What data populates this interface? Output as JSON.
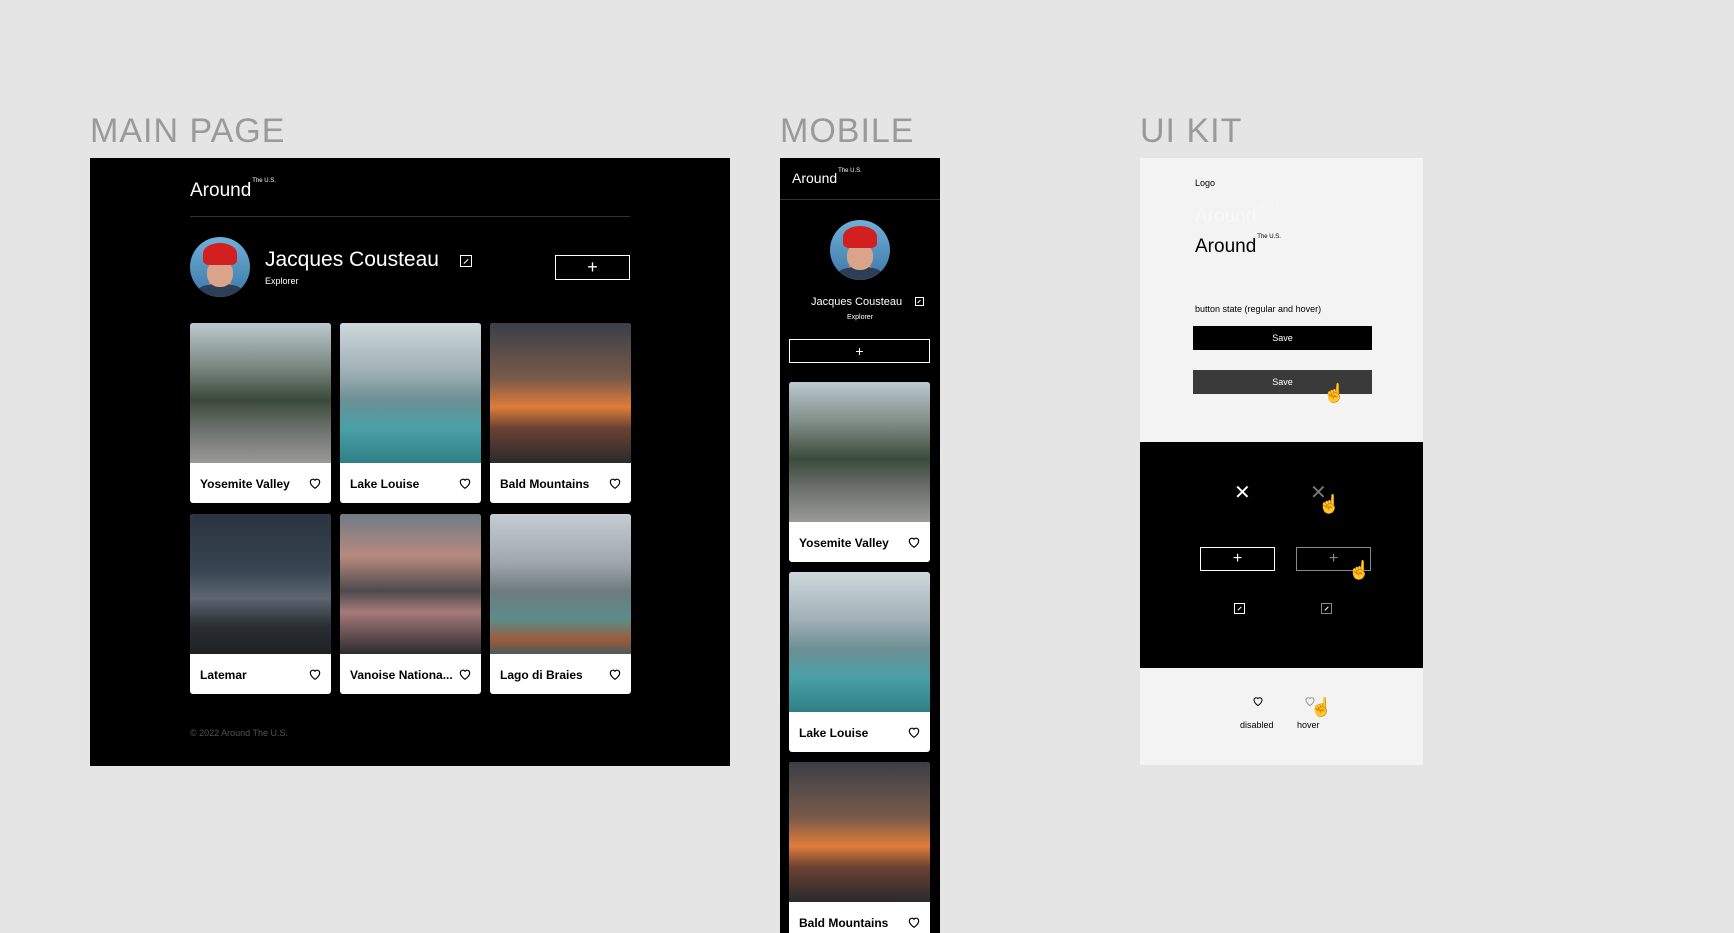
{
  "labels": {
    "main": "MAIN PAGE",
    "mobile": "MOBILE",
    "uikit": "UI KIT"
  },
  "brand": {
    "name": "Around",
    "suffix": "The U.S."
  },
  "profile": {
    "name": "Jacques Cousteau",
    "role": "Explorer"
  },
  "add_symbol": "+",
  "cards": [
    {
      "title": "Yosemite Valley"
    },
    {
      "title": "Lake Louise"
    },
    {
      "title": "Bald Mountains"
    },
    {
      "title": "Latemar"
    },
    {
      "title": "Vanoise Nationa..."
    },
    {
      "title": "Lago di Braies"
    }
  ],
  "footer": "© 2022 Around The U.S.",
  "uikit": {
    "logo_label": "Logo",
    "button_state_label": "button state (regular and hover)",
    "save_label": "Save",
    "close_symbol": "✕",
    "heart_disabled_label": "disabled",
    "heart_hover_label": "hover"
  },
  "colors": {
    "page_bg": "#e5e5e5",
    "frame_bg": "#000000",
    "card_bg": "#ffffff",
    "kit_bg": "#f3f3f3",
    "save_hover": "#3a3a3a"
  }
}
